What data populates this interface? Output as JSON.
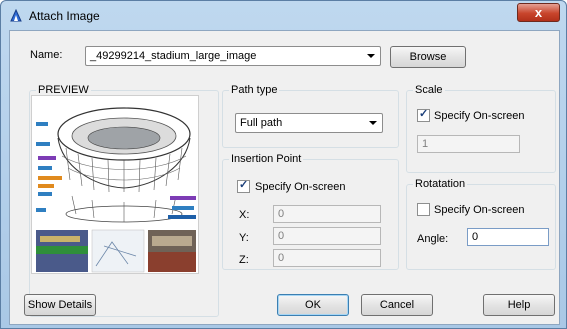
{
  "window": {
    "title": "Attach Image",
    "close_label": "x"
  },
  "name_row": {
    "label": "Name:",
    "selected": "_49299214_stadium_large_image",
    "browse_label": "Browse"
  },
  "preview": {
    "label": "PREVIEW"
  },
  "path_type": {
    "group_label": "Path type",
    "selected": "Full path"
  },
  "insertion_point": {
    "group_label": "Insertion Point",
    "specify_label": "Specify On-screen",
    "specify_checked": true,
    "x_label": "X:",
    "x_value": "0",
    "y_label": "Y:",
    "y_value": "0",
    "z_label": "Z:",
    "z_value": "0"
  },
  "scale": {
    "group_label": "Scale",
    "specify_label": "Specify On-screen",
    "specify_checked": true,
    "value": "1"
  },
  "rotation": {
    "group_label": "Rotatation",
    "specify_label": "Specify On-screen",
    "specify_checked": false,
    "angle_label": "Angle:",
    "angle_value": "0"
  },
  "footer": {
    "details_label": "Show Details",
    "ok_label": "OK",
    "cancel_label": "Cancel",
    "help_label": "Help"
  },
  "colors": {
    "titlebar": "#bfd8ef",
    "close_button": "#c8452c",
    "dialog_bg": "#f0f0f0",
    "app_icon": "#2f6bd6"
  }
}
